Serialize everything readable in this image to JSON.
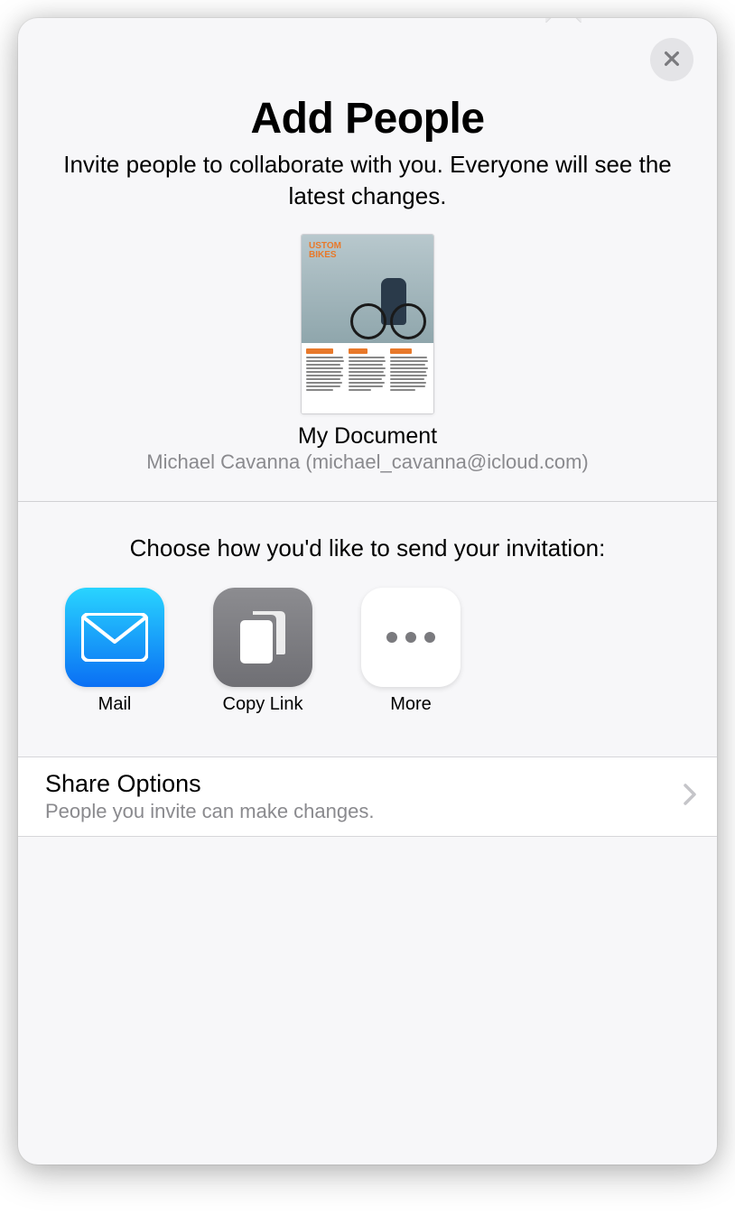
{
  "header": {
    "title": "Add People",
    "subtitle": "Invite people to collaborate with you. Everyone will see the latest changes."
  },
  "document": {
    "brand_line1": "USTOM",
    "brand_line2": "BIKES",
    "name": "My Document",
    "owner": "Michael Cavanna (michael_cavanna@icloud.com)"
  },
  "share": {
    "prompt": "Choose how you'd like to send your invitation:",
    "items": [
      {
        "label": "Mail"
      },
      {
        "label": "Copy Link"
      },
      {
        "label": "More"
      }
    ]
  },
  "options": {
    "title": "Share Options",
    "subtitle": "People you invite can make changes."
  }
}
